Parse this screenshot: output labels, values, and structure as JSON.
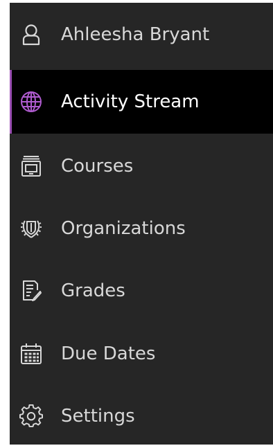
{
  "colors": {
    "background": "#262626",
    "active_background": "#000000",
    "active_accent": "#9b4fb3",
    "text": "#d8d8d8",
    "active_text": "#ffffff"
  },
  "nav": {
    "items": [
      {
        "label": "Ahleesha Bryant",
        "icon": "user-icon",
        "active": false
      },
      {
        "label": "Activity Stream",
        "icon": "globe-icon",
        "active": true
      },
      {
        "label": "Courses",
        "icon": "courses-icon",
        "active": false
      },
      {
        "label": "Organizations",
        "icon": "organizations-icon",
        "active": false
      },
      {
        "label": "Grades",
        "icon": "grades-icon",
        "active": false
      },
      {
        "label": "Due Dates",
        "icon": "calendar-icon",
        "active": false
      },
      {
        "label": "Settings",
        "icon": "gear-icon",
        "active": false
      }
    ]
  }
}
